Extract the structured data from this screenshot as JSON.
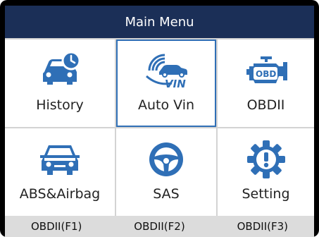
{
  "header": {
    "title": "Main Menu"
  },
  "menu": {
    "items": [
      {
        "label": "History",
        "icon": "history-car-icon",
        "selected": false
      },
      {
        "label": "Auto Vin",
        "icon": "auto-vin-icon",
        "selected": true,
        "icon_text": "VIN"
      },
      {
        "label": "OBDII",
        "icon": "obd-engine-icon",
        "selected": false,
        "icon_text": "OBD"
      },
      {
        "label": "ABS&Airbag",
        "icon": "abs-airbag-car-icon",
        "selected": false
      },
      {
        "label": "SAS",
        "icon": "steering-wheel-icon",
        "selected": false
      },
      {
        "label": "Setting",
        "icon": "gear-warning-icon",
        "selected": false
      }
    ]
  },
  "function_keys": [
    {
      "label": "OBDII(F1)"
    },
    {
      "label": "OBDII(F2)"
    },
    {
      "label": "OBDII(F3)"
    }
  ],
  "colors": {
    "title_bar": "#1b2f57",
    "icon_blue": "#2f6fb6",
    "selection_border": "#2f6fb6"
  }
}
